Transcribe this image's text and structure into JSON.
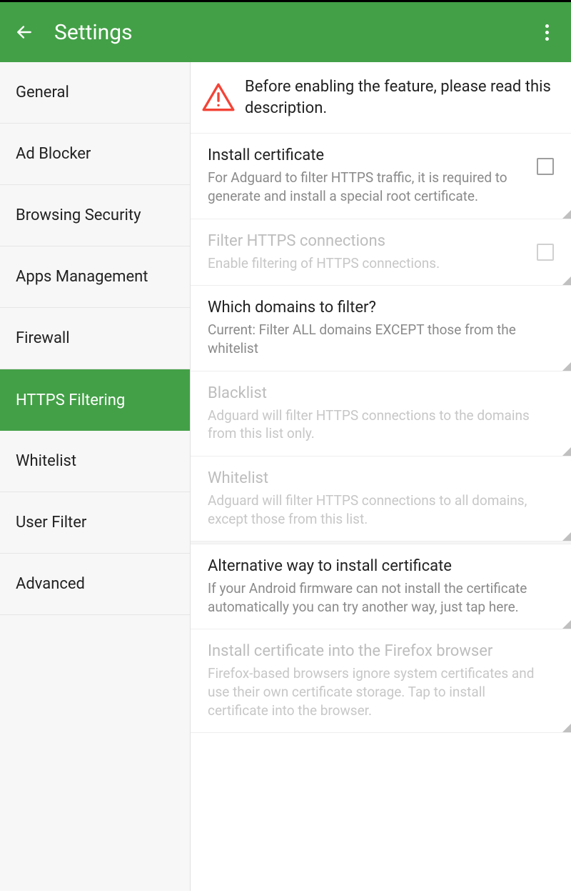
{
  "colors": {
    "accent": "#43a047",
    "warning": "#f44336"
  },
  "header": {
    "title": "Settings"
  },
  "sidebar": {
    "items": [
      {
        "label": "General"
      },
      {
        "label": "Ad Blocker"
      },
      {
        "label": "Browsing Security"
      },
      {
        "label": "Apps Management"
      },
      {
        "label": "Firewall"
      },
      {
        "label": "HTTPS Filtering",
        "selected": true
      },
      {
        "label": "Whitelist"
      },
      {
        "label": "User Filter"
      },
      {
        "label": "Advanced"
      }
    ]
  },
  "warning": {
    "text": "Before enabling the feature, please read this description."
  },
  "settings": [
    {
      "id": "install-certificate",
      "title": "Install certificate",
      "subtitle": "For Adguard to filter HTTPS traffic, it is required to generate and install a special root certificate.",
      "checkbox": true,
      "checked": false,
      "disabled": false
    },
    {
      "id": "filter-https-connections",
      "title": "Filter HTTPS connections",
      "subtitle": "Enable filtering of HTTPS connections.",
      "checkbox": true,
      "checked": false,
      "disabled": true
    },
    {
      "id": "which-domains",
      "title": "Which domains to filter?",
      "subtitle": "Current: Filter ALL domains EXCEPT those from the whitelist",
      "checkbox": false,
      "disabled": false
    },
    {
      "id": "blacklist",
      "title": "Blacklist",
      "subtitle": "Adguard will filter HTTPS connections to the domains from this list only.",
      "checkbox": false,
      "disabled": true
    },
    {
      "id": "whitelist",
      "title": "Whitelist",
      "subtitle": "Adguard will filter HTTPS connections to all domains, except those from this list.",
      "checkbox": false,
      "disabled": true
    },
    {
      "id": "alternative-install",
      "title": "Alternative way to install certificate",
      "subtitle": "If your Android firmware can not install the certificate automatically you can try another way, just tap here.",
      "checkbox": false,
      "disabled": false
    },
    {
      "id": "install-firefox",
      "title": "Install certificate into the Firefox browser",
      "subtitle": "Firefox-based browsers ignore system certificates and use their own certificate storage. Tap to install certificate into the browser.",
      "checkbox": false,
      "disabled": true
    }
  ]
}
